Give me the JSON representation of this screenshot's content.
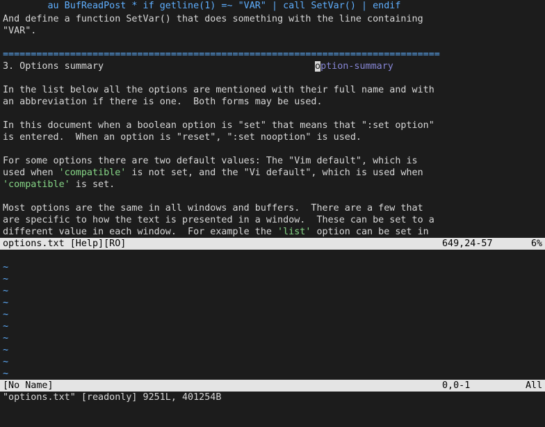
{
  "help": {
    "l1": {
      "pre": "        ",
      "cmd": "au BufReadPost * if getline(1) =~ \"VAR\" | call SetVar() | endif"
    },
    "l2": "And define a function SetVar() that does something with the line containing",
    "l3": "\"VAR\".",
    "separator": "==============================================================================",
    "heading": "3. Options summary",
    "tag_cursor_char": "o",
    "tag_rest": "ption-summary",
    "p1a": "In the list below all the options are mentioned with their full name and with",
    "p1b": "an abbreviation if there is one.  Both forms may be used.",
    "p2a": "In this document when a boolean option is \"set\" that means that \":set option\"",
    "p2b": "is entered.  When an option is \"reset\", \":set nooption\" is used.",
    "p3a": "For some options there are two default values: The \"Vim default\", which is",
    "p3b_pre": "used when ",
    "p3b_opt": "'compatible'",
    "p3b_post": " is not set, and the \"Vi default\", which is used when",
    "p3c_opt": "'compatible'",
    "p3c_post": " is set.",
    "p4a": "Most options are the same in all windows and buffers.  There are a few that",
    "p4b": "are specific to how the text is presented in a window.  These can be set to a",
    "p4c_pre": "different value in each window.  For example the ",
    "p4c_opt": "'list'",
    "p4c_post": " option can be set in"
  },
  "status_top": {
    "file": "options.txt [Help][RO]",
    "pos": "649,24-57",
    "pct": "6%"
  },
  "tilde": "~",
  "status_bottom": {
    "file": "[No Name]",
    "pos": "0,0-1",
    "pct": "All"
  },
  "cmdline": "\"options.txt\" [readonly] 9251L, 401254B"
}
